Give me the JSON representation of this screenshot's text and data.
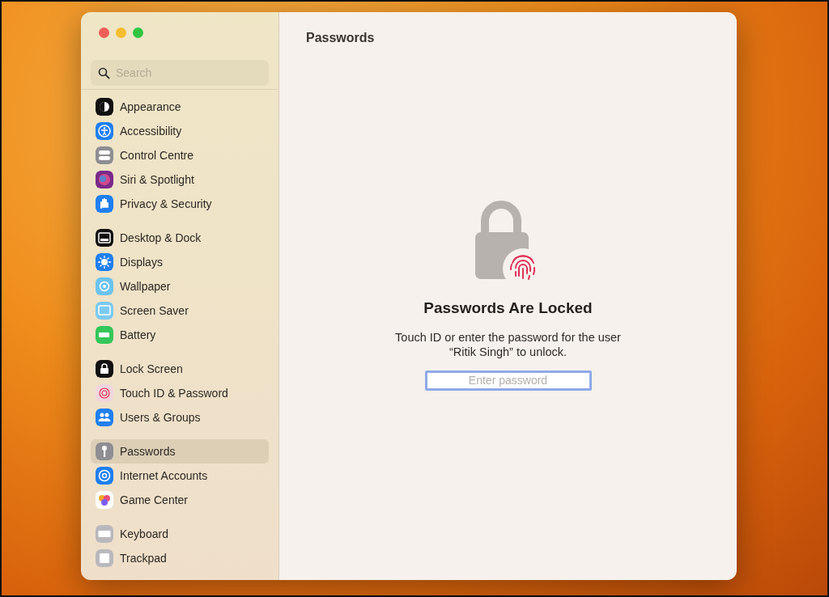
{
  "window": {
    "title": "Passwords"
  },
  "search": {
    "placeholder": "Search"
  },
  "sidebar": {
    "groups": [
      {
        "items": [
          {
            "label": "Appearance",
            "selected": false
          },
          {
            "label": "Accessibility",
            "selected": false
          },
          {
            "label": "Control Centre",
            "selected": false
          },
          {
            "label": "Siri & Spotlight",
            "selected": false
          },
          {
            "label": "Privacy & Security",
            "selected": false
          }
        ]
      },
      {
        "items": [
          {
            "label": "Desktop & Dock",
            "selected": false
          },
          {
            "label": "Displays",
            "selected": false
          },
          {
            "label": "Wallpaper",
            "selected": false
          },
          {
            "label": "Screen Saver",
            "selected": false
          },
          {
            "label": "Battery",
            "selected": false
          }
        ]
      },
      {
        "items": [
          {
            "label": "Lock Screen",
            "selected": false
          },
          {
            "label": "Touch ID & Password",
            "selected": false
          },
          {
            "label": "Users & Groups",
            "selected": false
          }
        ]
      },
      {
        "items": [
          {
            "label": "Passwords",
            "selected": true
          },
          {
            "label": "Internet Accounts",
            "selected": false
          },
          {
            "label": "Game Center",
            "selected": false
          }
        ]
      },
      {
        "items": [
          {
            "label": "Keyboard",
            "selected": false
          },
          {
            "label": "Trackpad",
            "selected": false
          }
        ]
      }
    ]
  },
  "locked": {
    "heading": "Passwords Are Locked",
    "message": "Touch ID or enter the password for the user “Ritik Singh” to unlock.",
    "password_placeholder": "Enter password"
  }
}
